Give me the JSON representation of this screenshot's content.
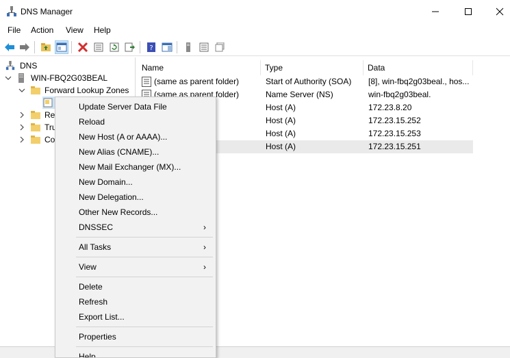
{
  "window": {
    "title": "DNS Manager",
    "controls": {
      "minimize": "—",
      "maximize": "☐",
      "close": "✕"
    }
  },
  "menubar": [
    "File",
    "Action",
    "View",
    "Help"
  ],
  "toolbar": {
    "icons": [
      "back-arrow-icon",
      "forward-arrow-icon",
      "up-folder-icon",
      "show-hide-tree-icon",
      "delete-icon",
      "properties-icon",
      "refresh-icon",
      "export-list-icon",
      "help-icon",
      "action-pane-icon",
      "server-icon",
      "list-icon",
      "detail-icon"
    ]
  },
  "tree": {
    "root": "DNS",
    "server": "WIN-FBQ2G03BEAL",
    "forward": "Forward Lookup Zones",
    "reverse": "Rev",
    "trust": "Tru",
    "conditional": "Co"
  },
  "list": {
    "columns": [
      "Name",
      "Type",
      "Data"
    ],
    "rows": [
      {
        "name": "(same as parent folder)",
        "type": "Start of Authority (SOA)",
        "data": "[8], win-fbq2g03beal., hos..."
      },
      {
        "name": "(same as parent folder)",
        "type": "Name Server (NS)",
        "data": "win-fbq2g03beal."
      },
      {
        "name": "",
        "type": "Host (A)",
        "data": "172.23.8.20"
      },
      {
        "name": "",
        "type": "Host (A)",
        "data": "172.23.15.252"
      },
      {
        "name": "",
        "type": "Host (A)",
        "data": "172.23.15.253"
      },
      {
        "name": "",
        "type": "Host (A)",
        "data": "172.23.15.251"
      }
    ]
  },
  "context_menu": {
    "items": [
      "Update Server Data File",
      "Reload",
      "New Host (A or AAAA)...",
      "New Alias (CNAME)...",
      "New Mail Exchanger (MX)...",
      "New Domain...",
      "New Delegation...",
      "Other New Records...",
      "DNSSEC",
      "All Tasks",
      "View",
      "Delete",
      "Refresh",
      "Export List...",
      "Properties",
      "Help"
    ],
    "submenu_arrow": "›"
  },
  "colors": {
    "selection": "#cce4f7",
    "menu_bg": "#f2f2f2",
    "folder": "#e8c25a",
    "back_arrow": "#1e8fd8",
    "delete_red": "#d32f2f"
  }
}
